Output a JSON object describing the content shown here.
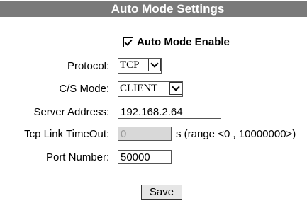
{
  "header": {
    "title": "Auto Mode Settings"
  },
  "auto_mode": {
    "label": "Auto Mode Enable",
    "checked": true
  },
  "fields": {
    "protocol": {
      "label": "Protocol",
      "value": "TCP"
    },
    "cs_mode": {
      "label": "C/S Mode",
      "value": "CLIENT"
    },
    "server_address": {
      "label": "Server Address",
      "value": "192.168.2.64"
    },
    "tcp_timeout": {
      "label": "Tcp Link TimeOut",
      "value": "0",
      "hint": "s (range <0 , 10000000>)"
    },
    "port_number": {
      "label": "Port Number",
      "value": "50000"
    }
  },
  "colon": ":",
  "save_label": "Save"
}
